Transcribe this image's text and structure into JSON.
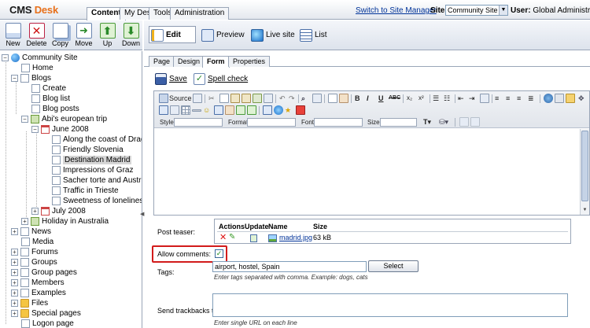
{
  "header": {
    "logo_part1": "CMS",
    "logo_part2": "Desk",
    "tabs": [
      {
        "label": "Content",
        "active": true
      },
      {
        "label": "My Desk",
        "active": false
      },
      {
        "label": "Tools",
        "active": false
      },
      {
        "label": "Administration",
        "active": false
      }
    ],
    "switch_link": "Switch to Site Manager",
    "site_label": "Site:",
    "site_value": "Community Site",
    "user_label": "User:",
    "user_value": "Global Administrator"
  },
  "left_toolbar": {
    "new": "New",
    "delete": "Delete",
    "copy": "Copy",
    "move": "Move",
    "up": "Up",
    "down": "Down"
  },
  "tree": {
    "root": "Community Site",
    "home": "Home",
    "blogs": "Blogs",
    "create": "Create",
    "blog_list": "Blog list",
    "blog_posts": "Blog posts",
    "abi": "Abi's european trip",
    "june": "June 2008",
    "posts": [
      "Along the coast of Drago",
      "Friendly Slovenia",
      "Destination Madrid",
      "Impressions of Graz",
      "Sacher torte and Austria",
      "Traffic in Trieste",
      "Sweetness of loneliness"
    ],
    "july": "July 2008",
    "holiday": "Holiday in Australia",
    "others": [
      "News",
      "Media",
      "Forums",
      "Groups",
      "Group pages",
      "Members",
      "Examples",
      "Files",
      "Special pages",
      "Logon page"
    ]
  },
  "edit_toolbar": {
    "edit": "Edit",
    "preview": "Preview",
    "live_site": "Live site",
    "list": "List"
  },
  "subtabs": [
    {
      "label": "Page",
      "active": false
    },
    {
      "label": "Design",
      "active": false
    },
    {
      "label": "Form",
      "active": true
    },
    {
      "label": "Properties",
      "active": false
    }
  ],
  "actions": {
    "save": "Save",
    "spell_check": "Spell check"
  },
  "editor": {
    "source": "Source",
    "style_label": "Style",
    "format_label": "Format",
    "font_label": "Font",
    "size_label": "Size",
    "bold": "B",
    "italic": "I",
    "underline": "U",
    "strike": "ABC"
  },
  "form": {
    "post_teaser_label": "Post teaser:",
    "attach_headers": {
      "actions": "Actions",
      "update": "Update",
      "name": "Name",
      "size": "Size"
    },
    "attachment": {
      "name": "madrid.jpg",
      "size": "63 kB"
    },
    "allow_comments_label": "Allow comments:",
    "allow_comments_checked": true,
    "tags_label": "Tags:",
    "tags_value": "airport, hostel, Spain",
    "select_button": "Select",
    "tags_hint": "Enter tags separated with comma. Example: dogs, cats",
    "trackbacks_label": "Send trackbacks to:",
    "trackbacks_hint": "Enter single URL on each line"
  },
  "colors": {
    "accent_orange": "#e8701a",
    "highlight_red": "#d21b1b",
    "link_blue": "#003399"
  }
}
